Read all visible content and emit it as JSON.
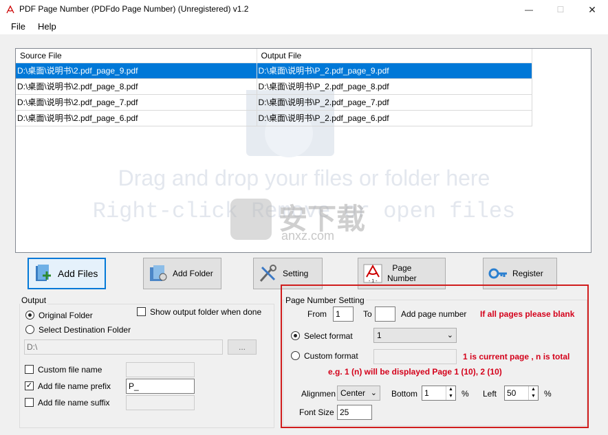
{
  "window": {
    "title": "PDF Page Number  (PDFdo Page Number)   (Unregistered) v1.2",
    "minimize": "—",
    "maximize": "☐",
    "close": "✕"
  },
  "menu": [
    "File",
    "Help"
  ],
  "file_list": {
    "columns": [
      "Source File",
      "Output File"
    ],
    "rows": [
      {
        "source": "D:\\桌面\\说明书\\2.pdf_page_9.pdf",
        "output": "D:\\桌面\\说明书\\P_2.pdf_page_9.pdf",
        "selected": true
      },
      {
        "source": "D:\\桌面\\说明书\\2.pdf_page_8.pdf",
        "output": "D:\\桌面\\说明书\\P_2.pdf_page_8.pdf",
        "selected": false
      },
      {
        "source": "D:\\桌面\\说明书\\2.pdf_page_7.pdf",
        "output": "D:\\桌面\\说明书\\P_2.pdf_page_7.pdf",
        "selected": false
      },
      {
        "source": "D:\\桌面\\说明书\\2.pdf_page_6.pdf",
        "output": "D:\\桌面\\说明书\\P_2.pdf_page_6.pdf",
        "selected": false
      }
    ],
    "drop_hint_line1": "Drag and drop your files or folder here",
    "drop_hint_line2": "Right-click Remove  or  open files",
    "watermark_text": "安下载",
    "watermark_sub": "anxz.com"
  },
  "toolbar": {
    "add_files": "Add Files",
    "add_folder": "Add Folder",
    "setting": "Setting",
    "page_number_line1": "Page",
    "page_number_line2": "Number",
    "page_icon_label": "- 1 -",
    "register": "Register"
  },
  "output": {
    "group_label": "Output",
    "original_folder": "Original Folder",
    "select_destination": "Select Destination Folder",
    "show_output_folder": "Show output folder when done",
    "destination_path": "D:\\",
    "browse_label": "...",
    "custom_file_name": "Custom file name",
    "add_prefix": "Add file name prefix",
    "prefix_value": "P_",
    "add_suffix": "Add file name suffix"
  },
  "page_number_setting": {
    "group_label": "Page Number Setting",
    "from_label": "From",
    "from_value": "1",
    "to_label": "To",
    "to_value": "",
    "add_page_number": "Add page number",
    "blank_hint": "If all pages please blank",
    "select_format_label": "Select format",
    "select_format_value": "1",
    "custom_format_label": "Custom format",
    "custom_hint": "1 is current page , n is total",
    "example_hint": "e.g.  1 (n) will be displayed Page 1 (10), 2 (10)",
    "alignment_label": "Alignmen",
    "alignment_value": "Center",
    "bottom_label": "Bottom",
    "bottom_value": "1",
    "percent": "%",
    "left_label": "Left",
    "left_value": "50",
    "font_size_label": "Font Size",
    "font_size_value": "25"
  },
  "colors": {
    "selection": "#0078d7",
    "highlight_border": "#d01c1c",
    "hint_red": "#d4001a"
  }
}
